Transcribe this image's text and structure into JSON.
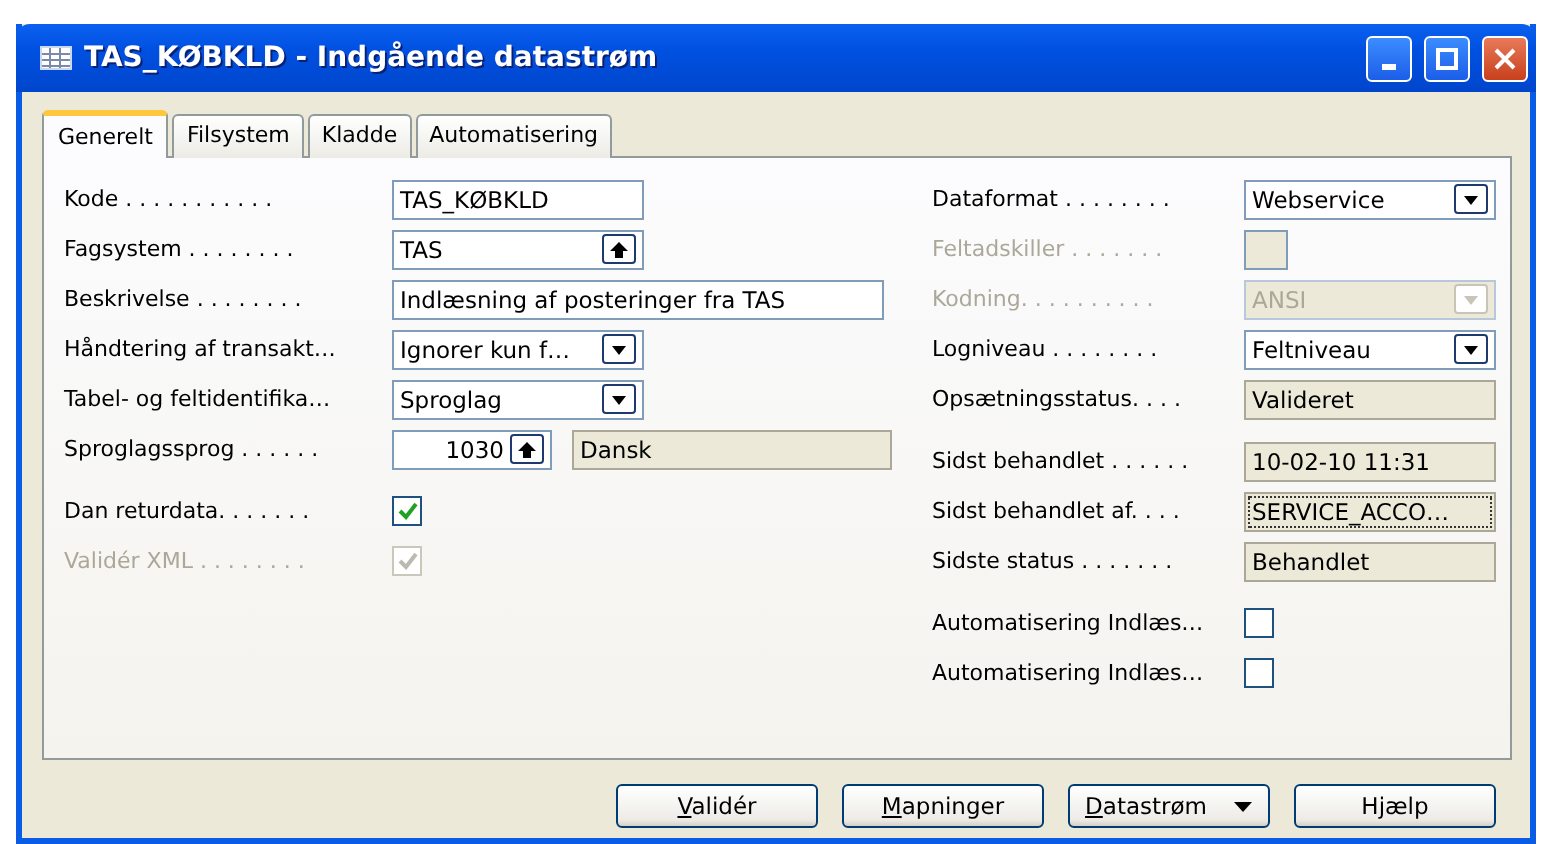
{
  "window": {
    "title": "TAS_KØBKLD - Indgående datastrøm"
  },
  "tabs": [
    {
      "label": "Generelt",
      "selected": true
    },
    {
      "label": "Filsystem",
      "selected": false
    },
    {
      "label": "Kladde",
      "selected": false
    },
    {
      "label": "Automatisering",
      "selected": false
    }
  ],
  "left_groups": [
    [
      {
        "kind": "text",
        "label": "Kode . . . . . . . . . . .",
        "value": "TAS_KØBKLD",
        "disabled": false
      },
      {
        "kind": "lookup",
        "label": "Fagsystem . . . . . . . .",
        "value": "TAS",
        "disabled": false
      },
      {
        "kind": "long_text",
        "label": "Beskrivelse . . . . . . . .",
        "value": "Indlæsning af posteringer fra TAS",
        "disabled": false
      },
      {
        "kind": "dropdown",
        "label": "Håndtering af transakt…",
        "value": "Ignorer kun f…",
        "disabled": false
      },
      {
        "kind": "dropdown",
        "label": "Tabel- og feltidentifika…",
        "value": "Sproglag",
        "disabled": false
      },
      {
        "kind": "number_lookup",
        "label": "Sproglagssprog . . . . . .",
        "value": "1030",
        "side_value": "Dansk",
        "disabled": false
      }
    ],
    [
      {
        "kind": "checkbox",
        "label": "Dan returdata. . . . . . .",
        "checked": true,
        "disabled": false
      },
      {
        "kind": "checkbox",
        "label": "Validér XML . . . . . . . .",
        "checked": true,
        "disabled": true
      }
    ]
  ],
  "right_groups": [
    [
      {
        "kind": "dropdown",
        "label": "Dataformat . . . . . . . .",
        "value": "Webservice",
        "disabled": false
      },
      {
        "kind": "empty_box",
        "label": "Feltadskiller . . . . . . .",
        "disabled": true
      },
      {
        "kind": "dropdown",
        "label": "Kodning. . . . . . . . . .",
        "value": "ANSI",
        "disabled": true
      },
      {
        "kind": "dropdown",
        "label": "Logniveau . . . . . . . .",
        "value": "Feltniveau",
        "disabled": false
      },
      {
        "kind": "readonly",
        "label": "Opsætningsstatus. . . .",
        "value": "Valideret",
        "disabled": false
      }
    ],
    [
      {
        "kind": "readonly",
        "label": "Sidst behandlet . . . . . .",
        "value": "10-02-10 11:31",
        "disabled": false
      },
      {
        "kind": "readonly",
        "label": "Sidst behandlet af. . . .",
        "value": "SERVICE_ACCO…",
        "disabled": false,
        "focused": true
      },
      {
        "kind": "readonly",
        "label": "Sidste status . . . . . . .",
        "value": "Behandlet",
        "disabled": false
      }
    ],
    [
      {
        "kind": "checkbox",
        "label": "Automatisering Indlæs…",
        "checked": false,
        "disabled": false
      },
      {
        "kind": "checkbox",
        "label": "Automatisering Indlæs…",
        "checked": false,
        "disabled": false
      }
    ]
  ],
  "buttons": [
    {
      "kind": "plain",
      "access": "V",
      "rest": "alidér"
    },
    {
      "kind": "plain",
      "access": "M",
      "rest": "apninger"
    },
    {
      "kind": "menu",
      "access": "D",
      "rest": "atastrøm"
    },
    {
      "kind": "plain",
      "rest": "Hjælp"
    }
  ]
}
